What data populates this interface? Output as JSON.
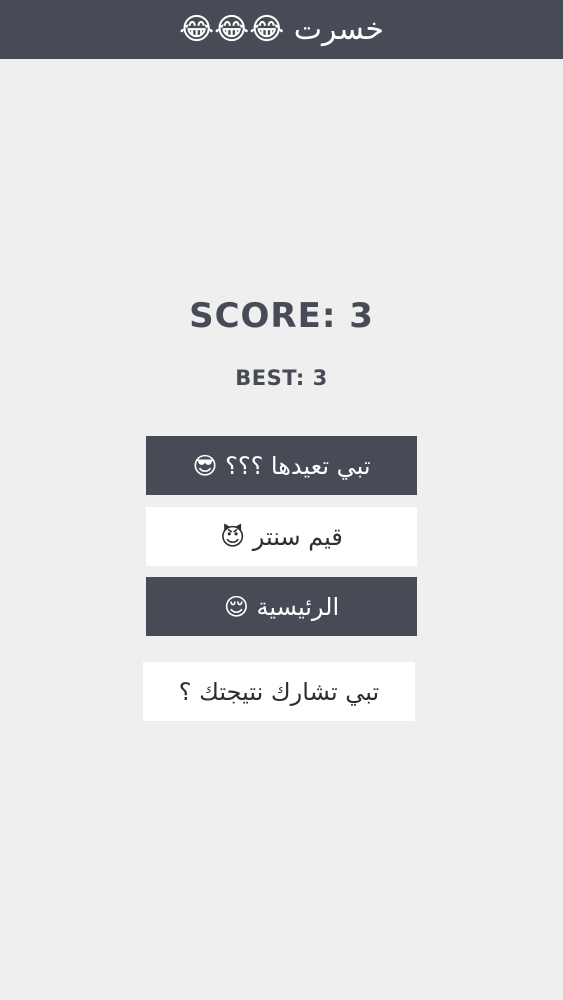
{
  "header": {
    "title": "خسرت 😂😂😂"
  },
  "score": {
    "label": "SCORE: 3",
    "value": 3
  },
  "best": {
    "label": "BEST: 3",
    "value": 3
  },
  "buttons": {
    "retry": "تبي تعيدها ؟؟؟ 😎",
    "game_center": "قيم سنتر 😈",
    "home": "الرئيسية 😌",
    "share": "تبي تشارك نتيجتك ؟"
  },
  "colors": {
    "header_bg": "#474b55",
    "page_bg": "#efefef",
    "dark_button": "#474b55",
    "light_button": "#ffffff",
    "score_text": "#474b55"
  }
}
